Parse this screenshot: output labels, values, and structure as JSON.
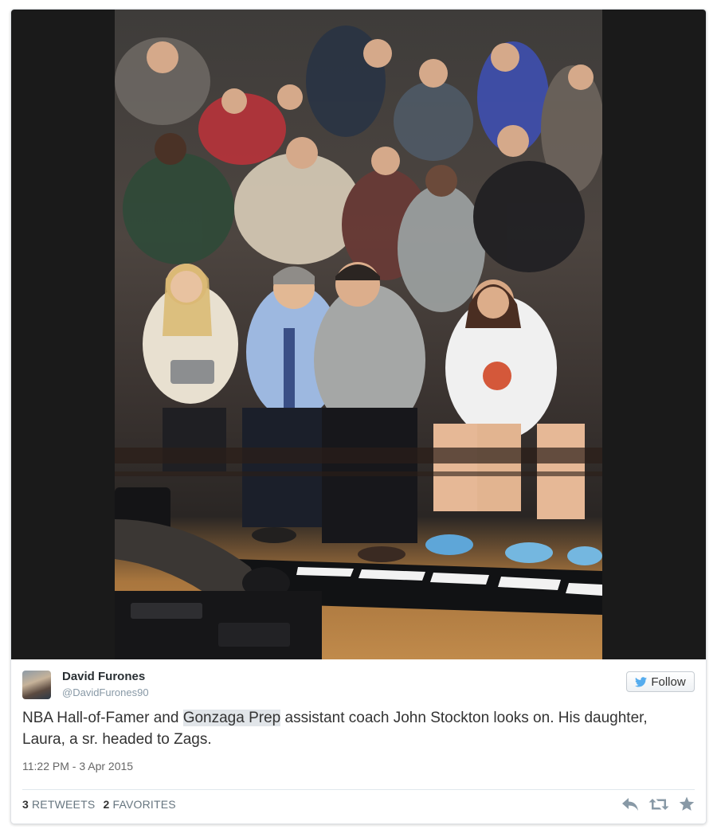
{
  "tweet": {
    "display_name": "David Furones",
    "handle": "@DavidFurones90",
    "follow_label": "Follow",
    "text_before": "NBA Hall-of-Famer and ",
    "text_highlight": "Gonzaga Prep",
    "text_after": " assistant coach John Stockton looks on. His daughter, Laura, a sr. headed to Zags.",
    "timestamp": "11:22 PM - 3 Apr 2015",
    "retweet_count": "3",
    "retweet_label": "RETWEETS",
    "favorite_count": "2",
    "favorite_label": "FAVORITES"
  },
  "icons": {
    "follow": "twitter-bird-icon",
    "reply": "reply-icon",
    "retweet": "retweet-icon",
    "favorite": "star-icon"
  },
  "colors": {
    "twitter_blue": "#55acee",
    "name_text": "#292f33",
    "meta_text": "#8899a6",
    "action_icon": "#8899a6",
    "highlight_bg": "#e1e5e9"
  }
}
